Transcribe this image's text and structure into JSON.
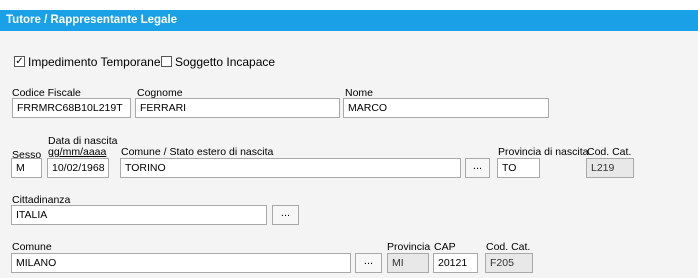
{
  "section": {
    "title": "Tutore / Rappresentante Legale"
  },
  "checkboxes": [
    {
      "label": "Impedimento Temporaneo",
      "checked": true,
      "mark": "✓"
    },
    {
      "label": "Soggetto Incapace",
      "checked": false,
      "mark": ""
    }
  ],
  "fields": {
    "codice_fiscale": {
      "label": "Codice Fiscale",
      "value": "FRRMRC68B10L219T"
    },
    "cognome": {
      "label": "Cognome",
      "value": "FERRARI"
    },
    "nome": {
      "label": "Nome",
      "value": "MARCO"
    },
    "sesso": {
      "label": "Sesso",
      "value": "M"
    },
    "data_nascita": {
      "label": "Data di nascita",
      "format": "gg/mm/aaaa",
      "value": "10/02/1968"
    },
    "comune_nascita": {
      "label": "Comune / Stato estero di nascita",
      "value": "TORINO",
      "button": "..."
    },
    "provincia_nascita": {
      "label": "Provincia di nascita",
      "value": "TO"
    },
    "cod_cat_nascita": {
      "label": "Cod. Cat.",
      "value": "L219"
    },
    "cittadinanza": {
      "label": "Cittadinanza",
      "value": "ITALIA",
      "button": "..."
    },
    "comune": {
      "label": "Comune",
      "value": "MILANO",
      "button": "..."
    },
    "provincia": {
      "label": "Provincia",
      "value": "MI"
    },
    "cap": {
      "label": "CAP",
      "value": "20121"
    },
    "cod_cat": {
      "label": "Cod. Cat.",
      "value": "F205"
    }
  },
  "colors": {
    "header_bg": "#1aa0e6",
    "header_text": "#ffffff",
    "panel_bg": "#f4f4f4",
    "readonly_bg": "#e8e8e8"
  }
}
